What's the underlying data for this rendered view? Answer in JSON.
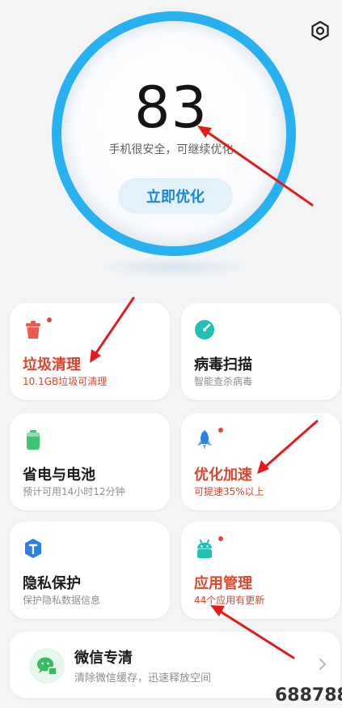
{
  "colors": {
    "accent": "#1aa6ea",
    "button_text": "#1c86d8",
    "alert": "#e0452c",
    "arrow": "#e21b1b",
    "icon_red": "#ea5a4f",
    "icon_teal": "#20c1b2",
    "icon_green": "#3cc66f",
    "icon_blue": "#2b7fe6"
  },
  "header": {
    "settings_icon": "gear-icon"
  },
  "score": {
    "value": "83",
    "status": "手机很安全，可继续优化",
    "button_label": "立即优化"
  },
  "cards": {
    "junk": {
      "icon": "trash-icon",
      "title": "垃圾清理",
      "subtitle": "10.1GB垃圾可清理",
      "badge": true
    },
    "virus": {
      "icon": "virus-scan-icon",
      "title": "病毒扫描",
      "subtitle": "智能查杀病毒",
      "badge": false
    },
    "battery": {
      "icon": "battery-icon",
      "title": "省电与电池",
      "subtitle": "预计可用14小时12分钟",
      "badge": false
    },
    "speed": {
      "icon": "rocket-icon",
      "title": "优化加速",
      "subtitle": "可提速35%以上",
      "badge": true
    },
    "privacy": {
      "icon": "shield-icon",
      "title": "隐私保护",
      "subtitle": "保护隐私数据信息",
      "badge": false
    },
    "apps": {
      "icon": "android-icon",
      "title": "应用管理",
      "subtitle": "44个应用有更新",
      "badge": true
    }
  },
  "wechat": {
    "icon": "wechat-icon",
    "title": "微信专清",
    "subtitle": "清除微信缓存，迅速释放空间"
  },
  "watermark": "688788"
}
